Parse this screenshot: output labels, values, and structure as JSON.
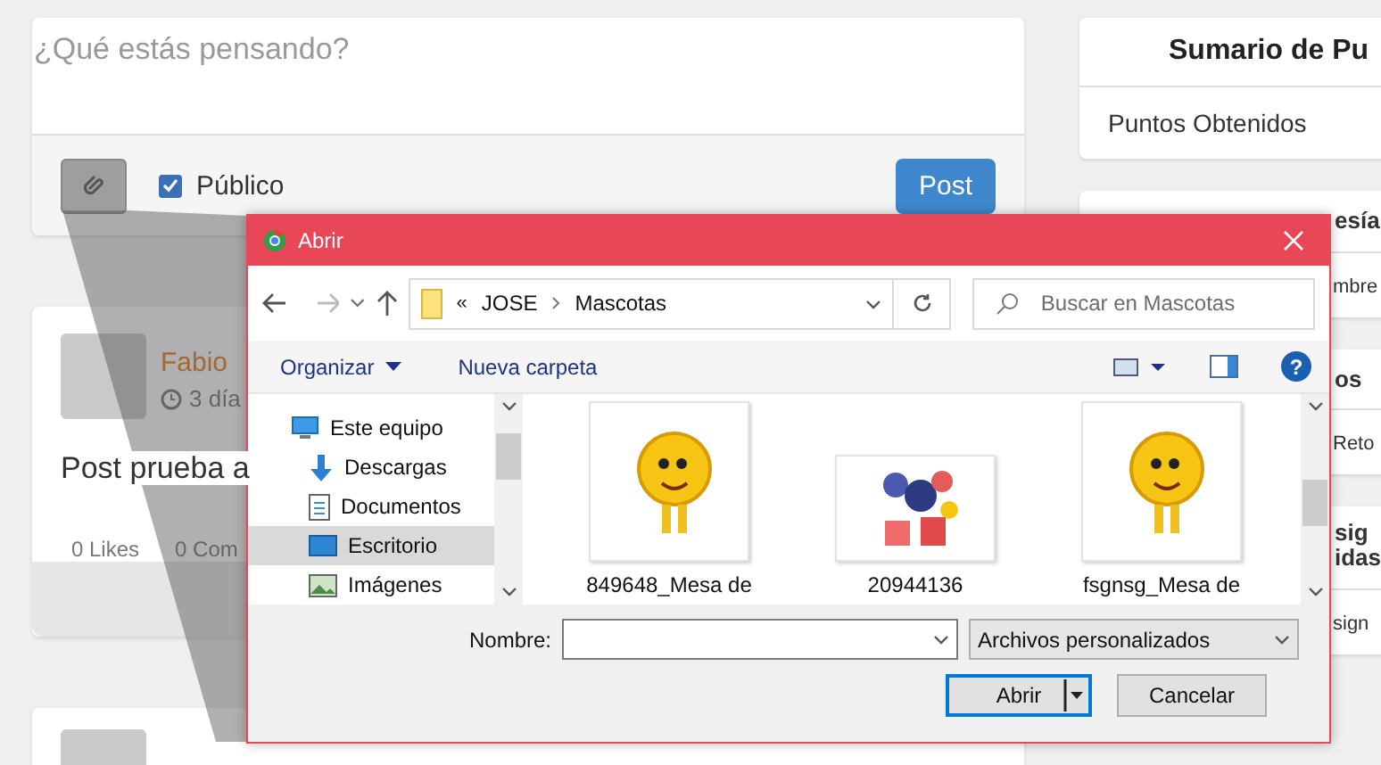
{
  "composer": {
    "placeholder": "¿Qué estás pensando?",
    "public": {
      "label": "Público",
      "checked": true
    },
    "post_button": "Post"
  },
  "post": {
    "author": "Fabio",
    "time": "3 día",
    "text": "Post prueba a",
    "likes": "0 Likes",
    "comments": "0 Com"
  },
  "summary": {
    "title": "Sumario de Pu",
    "rows": [
      "Puntos Obtenidos"
    ]
  },
  "side_cards": [
    {
      "title": "esía",
      "rows": [
        "mbre"
      ]
    },
    {
      "title": "os",
      "rows": [
        "Reto"
      ]
    },
    {
      "title": "sig\nidas",
      "rows": [
        "sign"
      ]
    }
  ],
  "dialog": {
    "title": "Abrir",
    "path_prefix": "«",
    "path": [
      "JOSE",
      "Mascotas"
    ],
    "help": "?",
    "search": {
      "placeholder": "Buscar en Mascotas"
    },
    "toolbar": [
      "Organizar",
      "Nueva carpeta"
    ],
    "nav_items": [
      {
        "label": "Este equipo",
        "kind": "computer",
        "selected": false,
        "children": [
          {
            "label": "Descargas",
            "kind": "download",
            "selected": false
          },
          {
            "label": "Documentos",
            "kind": "document",
            "selected": false
          },
          {
            "label": "Escritorio",
            "kind": "desktop",
            "selected": true
          },
          {
            "label": "Imágenes",
            "kind": "pictures",
            "selected": false
          }
        ]
      }
    ],
    "files": [
      {
        "name": "849648_Mesa de",
        "kind": "tall"
      },
      {
        "name": "20944136",
        "kind": "wide"
      },
      {
        "name": "fsgnsg_Mesa de",
        "kind": "tall"
      }
    ],
    "filename": {
      "label": "Nombre:"
    },
    "filetype": "Archivos personalizados",
    "buttons": [
      "Abrir",
      "Cancelar"
    ]
  }
}
